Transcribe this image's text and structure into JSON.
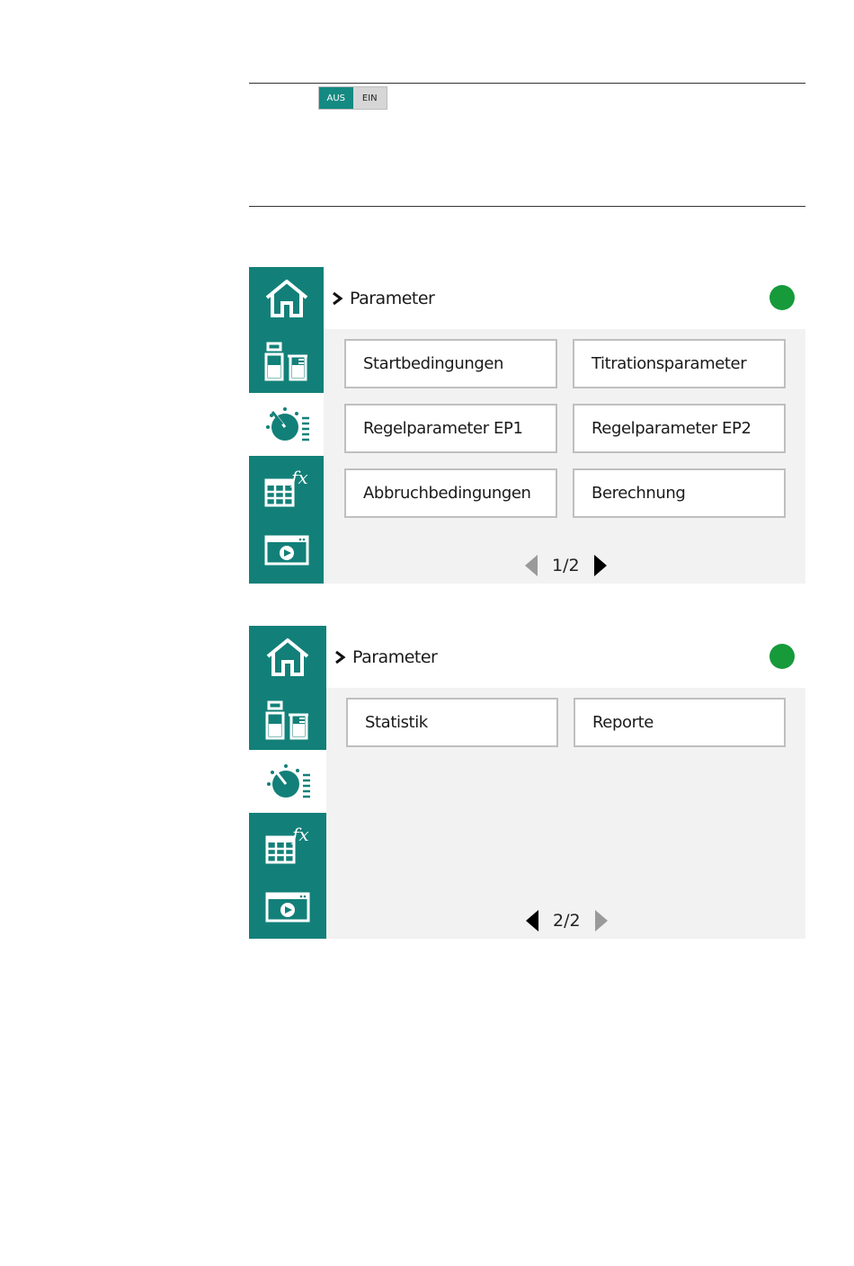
{
  "toggle": {
    "off_label": "AUS",
    "on_label": "EIN",
    "state": "AUS"
  },
  "colors": {
    "sidebar": "#128079",
    "status_ok": "#169a3a",
    "toggle_active": "#148a82"
  },
  "sidebar_items": [
    {
      "name": "home",
      "icon": "home-icon",
      "active": false
    },
    {
      "name": "samples",
      "icon": "bottle-beaker-icon",
      "active": false
    },
    {
      "name": "parameters",
      "icon": "dial-list-icon",
      "active": true
    },
    {
      "name": "formulas",
      "icon": "table-fx-icon",
      "active": false
    },
    {
      "name": "run",
      "icon": "window-play-icon",
      "active": false
    }
  ],
  "screens": [
    {
      "breadcrumb": "Parameter",
      "status": "online",
      "tiles": [
        "Startbedingungen",
        "Titrationsparameter",
        "Regelparameter EP1",
        "Regelparameter EP2",
        "Abbruchbedingungen",
        "Berechnung"
      ],
      "page": "1/2",
      "prev_enabled": false,
      "next_enabled": true
    },
    {
      "breadcrumb": "Parameter",
      "status": "online",
      "tiles": [
        "Statistik",
        "Reporte"
      ],
      "page": "2/2",
      "prev_enabled": true,
      "next_enabled": false
    }
  ]
}
